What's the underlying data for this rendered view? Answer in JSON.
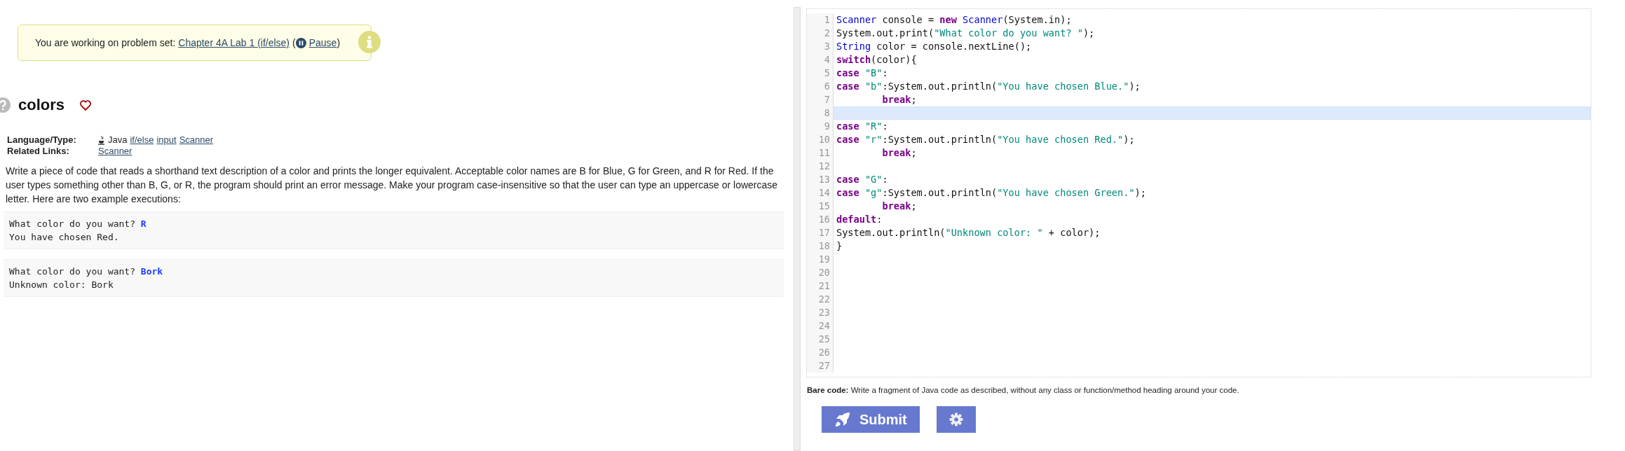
{
  "banner": {
    "prefix": "You are working on problem set:",
    "link": "Chapter 4A Lab 1 (if/else)",
    "open_paren": "(",
    "pause": "Pause",
    "close_paren": ")"
  },
  "problem": {
    "title": "colors",
    "favorite": false,
    "meta": [
      {
        "label": "Language/Type:",
        "language": "Java",
        "links": [
          "if/else",
          "input",
          "Scanner"
        ]
      },
      {
        "label": "Related Links:",
        "links": [
          "Scanner"
        ]
      }
    ],
    "description": "Write a piece of code that reads a shorthand text description of a color and prints the longer equivalent. Acceptable color names are B for Blue, G for Green, and R for Red. If the user types something other than B, G, or R, the program should print an error message. Make your program case-insensitive so that the user can type an uppercase or lowercase letter. Here are two example executions:",
    "samples": [
      [
        "What color do you want? **R**",
        "You have chosen Red."
      ],
      [
        "What color do you want? **Bork**",
        "Unknown color: Bork"
      ]
    ]
  },
  "editor": {
    "lines": [
      {
        "number": "1",
        "active": false,
        "tokens": [
          {
            "kind": "type",
            "text": "Scanner"
          },
          {
            "kind": "plain",
            "text": " console = "
          },
          {
            "kind": "keyword",
            "text": "new"
          },
          {
            "kind": "type",
            "text": " Scanner"
          },
          {
            "kind": "plain",
            "text": "(System.in);"
          }
        ]
      },
      {
        "number": "2",
        "active": false,
        "tokens": [
          {
            "kind": "plain",
            "text": "System.out.print("
          },
          {
            "kind": "string",
            "text": "\"What color do you want? \""
          },
          {
            "kind": "plain",
            "text": ");"
          }
        ]
      },
      {
        "number": "3",
        "active": false,
        "tokens": [
          {
            "kind": "type",
            "text": "String"
          },
          {
            "kind": "plain",
            "text": " color = console.nextLine();"
          }
        ]
      },
      {
        "number": "4",
        "active": false,
        "tokens": [
          {
            "kind": "keyword",
            "text": "switch"
          },
          {
            "kind": "plain",
            "text": "(color){"
          }
        ]
      },
      {
        "number": "5",
        "active": false,
        "tokens": [
          {
            "kind": "keyword",
            "text": "case"
          },
          {
            "kind": "string",
            "text": " \"B\""
          },
          {
            "kind": "plain",
            "text": ":"
          }
        ]
      },
      {
        "number": "6",
        "active": false,
        "tokens": [
          {
            "kind": "keyword",
            "text": "case"
          },
          {
            "kind": "string",
            "text": " \"b\""
          },
          {
            "kind": "plain",
            "text": ":System.out.println("
          },
          {
            "kind": "string",
            "text": "\"You have chosen Blue.\""
          },
          {
            "kind": "plain",
            "text": ");"
          }
        ]
      },
      {
        "number": "7",
        "active": false,
        "tokens": [
          {
            "kind": "keyword",
            "text": "        break"
          },
          {
            "kind": "plain",
            "text": ";"
          }
        ]
      },
      {
        "number": "8",
        "active": true
      },
      {
        "number": "9",
        "active": false,
        "tokens": [
          {
            "kind": "keyword",
            "text": "case"
          },
          {
            "kind": "string",
            "text": " \"R\""
          },
          {
            "kind": "plain",
            "text": ":"
          }
        ]
      },
      {
        "number": "10",
        "active": false,
        "tokens": [
          {
            "kind": "keyword",
            "text": "case"
          },
          {
            "kind": "string",
            "text": " \"r\""
          },
          {
            "kind": "plain",
            "text": ":System.out.println("
          },
          {
            "kind": "string",
            "text": "\"You have chosen Red.\""
          },
          {
            "kind": "plain",
            "text": ");"
          }
        ]
      },
      {
        "number": "11",
        "active": false,
        "tokens": [
          {
            "kind": "keyword",
            "text": "        break"
          },
          {
            "kind": "plain",
            "text": ";"
          }
        ]
      },
      {
        "number": "12",
        "active": false
      },
      {
        "number": "13",
        "active": false,
        "tokens": [
          {
            "kind": "keyword",
            "text": "case"
          },
          {
            "kind": "string",
            "text": " \"G\""
          },
          {
            "kind": "plain",
            "text": ":"
          }
        ]
      },
      {
        "number": "14",
        "active": false,
        "tokens": [
          {
            "kind": "keyword",
            "text": "case"
          },
          {
            "kind": "string",
            "text": " \"g\""
          },
          {
            "kind": "plain",
            "text": ":System.out.println("
          },
          {
            "kind": "string",
            "text": "\"You have chosen Green.\""
          },
          {
            "kind": "plain",
            "text": ");"
          }
        ]
      },
      {
        "number": "15",
        "active": false,
        "tokens": [
          {
            "kind": "keyword",
            "text": "        break"
          },
          {
            "kind": "plain",
            "text": ";"
          }
        ]
      },
      {
        "number": "16",
        "active": false,
        "tokens": [
          {
            "kind": "keyword",
            "text": "default"
          },
          {
            "kind": "plain",
            "text": ":"
          }
        ]
      },
      {
        "number": "17",
        "active": false,
        "tokens": [
          {
            "kind": "plain",
            "text": "System.out.println("
          },
          {
            "kind": "string",
            "text": "\"Unknown color: \""
          },
          {
            "kind": "plain",
            "text": " + color);"
          }
        ]
      },
      {
        "number": "18",
        "active": false,
        "tokens": [
          {
            "kind": "plain",
            "text": "}"
          }
        ]
      },
      {
        "number": "19",
        "active": false
      },
      {
        "number": "20",
        "active": false
      },
      {
        "number": "21",
        "active": false
      },
      {
        "number": "22",
        "active": false
      },
      {
        "number": "23",
        "active": false
      },
      {
        "number": "24",
        "active": false
      },
      {
        "number": "25",
        "active": false
      },
      {
        "number": "26",
        "active": false
      },
      {
        "number": "27",
        "active": false
      }
    ]
  },
  "note": "**Bare code:** Write a fragment of Java code as described, without any class or function/method heading around your code.",
  "submit": "Submit"
}
